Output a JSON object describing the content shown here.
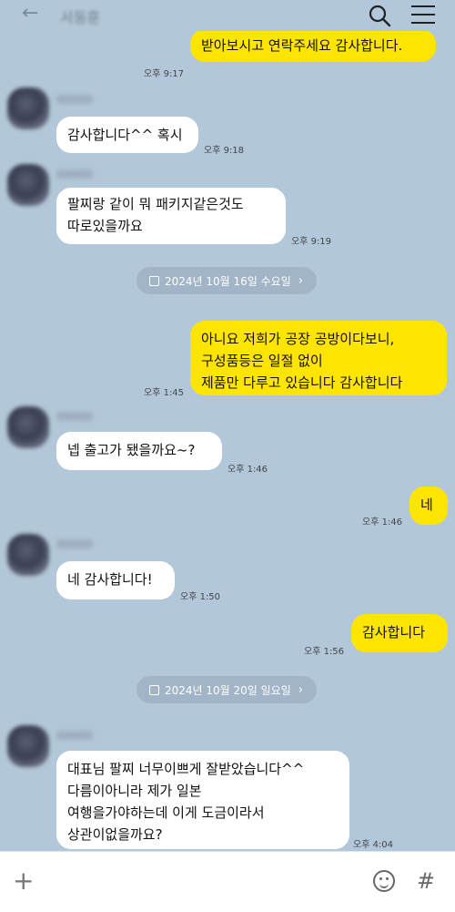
{
  "header": {
    "back_icon": "arrow-left-icon",
    "title": "서동훈",
    "search_icon": "search-icon",
    "menu_icon": "menu-icon"
  },
  "messages": [
    {
      "from": "me",
      "text": "받아보시고 연락주세요 감사합니다.",
      "time": "오후 9:17"
    },
    {
      "from": "them",
      "text": "감사합니다^^ 혹시",
      "time": "오후 9:18"
    },
    {
      "from": "them",
      "text": "팔찌랑 같이 뭐 패키지같은것도\n따로있을까요",
      "time": "오후 9:19"
    },
    {
      "from": "date",
      "text": "2024년 10월 16일 수요일"
    },
    {
      "from": "me",
      "text": "아니요 저희가 공장 공방이다보니,\n구성품등은 일절 없이\n제품만 다루고 있습니다 감사합니다",
      "time": "오후 1:45"
    },
    {
      "from": "them",
      "text": "넵 출고가 됐을까요~?",
      "time": "오후 1:46"
    },
    {
      "from": "me",
      "text": "네",
      "time": "오후 1:46"
    },
    {
      "from": "them",
      "text": "네 감사합니다!",
      "time": "오후 1:50"
    },
    {
      "from": "me",
      "text": "감사합니다",
      "time": "오후 1:56"
    },
    {
      "from": "date",
      "text": "2024년 10월 20일 일요일"
    },
    {
      "from": "them",
      "text": "대표님 팔찌 너무이쁘게 잘받았습니다^^\n다름이아니라 제가 일본\n여행을가야하는데 이게 도금이라서\n상관이없을까요?",
      "time": "오후 4:04"
    }
  ],
  "footer": {
    "plus_icon": "plus-icon",
    "plus": "+",
    "emoji_icon": "emoji-icon",
    "hash_icon": "hashtag-icon",
    "hash": "#"
  },
  "colors": {
    "background": "#b2c7da",
    "my_bubble": "#fee500",
    "their_bubble": "#ffffff",
    "date_pill": "#a2b5c8"
  }
}
